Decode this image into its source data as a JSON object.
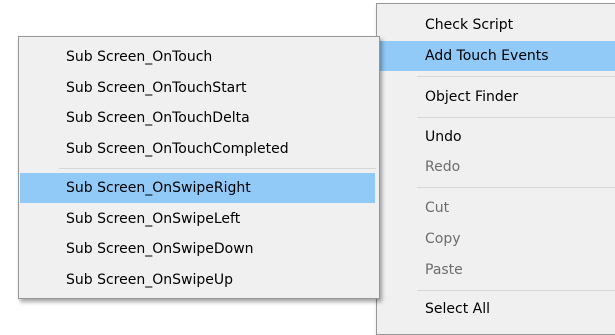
{
  "context_menu": {
    "items": [
      {
        "label": "Check Script",
        "enabled": true
      },
      {
        "label": "Add Touch Events",
        "enabled": true,
        "has_submenu": true,
        "submenu_glyph": "›"
      },
      {
        "label": "Object Finder",
        "enabled": true
      },
      {
        "label": "Undo",
        "enabled": true
      },
      {
        "label": "Redo",
        "enabled": false
      },
      {
        "label": "Cut",
        "enabled": false
      },
      {
        "label": "Copy",
        "enabled": false
      },
      {
        "label": "Paste",
        "enabled": false
      },
      {
        "label": "Select All",
        "enabled": true
      }
    ]
  },
  "submenu": {
    "items": [
      {
        "label": "Sub Screen_OnTouch"
      },
      {
        "label": "Sub Screen_OnTouchStart"
      },
      {
        "label": "Sub Screen_OnTouchDelta"
      },
      {
        "label": "Sub Screen_OnTouchCompleted"
      },
      {
        "label": "Sub Screen_OnSwipeRight",
        "highlighted": true
      },
      {
        "label": "Sub Screen_OnSwipeLeft"
      },
      {
        "label": "Sub Screen_OnSwipeDown"
      },
      {
        "label": "Sub Screen_OnSwipeUp"
      }
    ]
  },
  "colors": {
    "menu_background": "#f0f0f0",
    "highlight": "#91c9f7",
    "disabled_text": "#6d6d6d",
    "separator": "#d7d7d7"
  }
}
